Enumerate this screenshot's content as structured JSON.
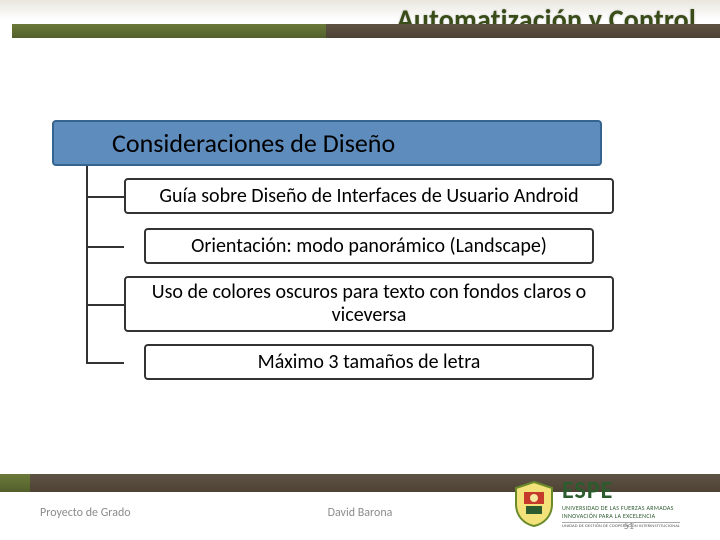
{
  "header": {
    "title": "Automatización y Control"
  },
  "content": {
    "main": "Consideraciones de Diseño",
    "subs": [
      "Guía sobre Diseño de Interfaces de Usuario Android",
      "Orientación: modo panorámico (Landscape)",
      "Uso de colores oscuros para texto con fondos claros o viceversa",
      "Máximo 3 tamaños de letra"
    ]
  },
  "footer": {
    "left": "Proyecto de Grado",
    "center": "David Barona",
    "page": "51"
  },
  "logo": {
    "name": "ESPE",
    "sub1": "UNIVERSIDAD DE LAS FUERZAS ARMADAS",
    "sub2": "INNOVACIÓN PARA LA EXCELENCIA",
    "sub3": "UNIDAD DE GESTIÓN DE COOPERACIÓN INTERINSTITUCIONAL"
  }
}
